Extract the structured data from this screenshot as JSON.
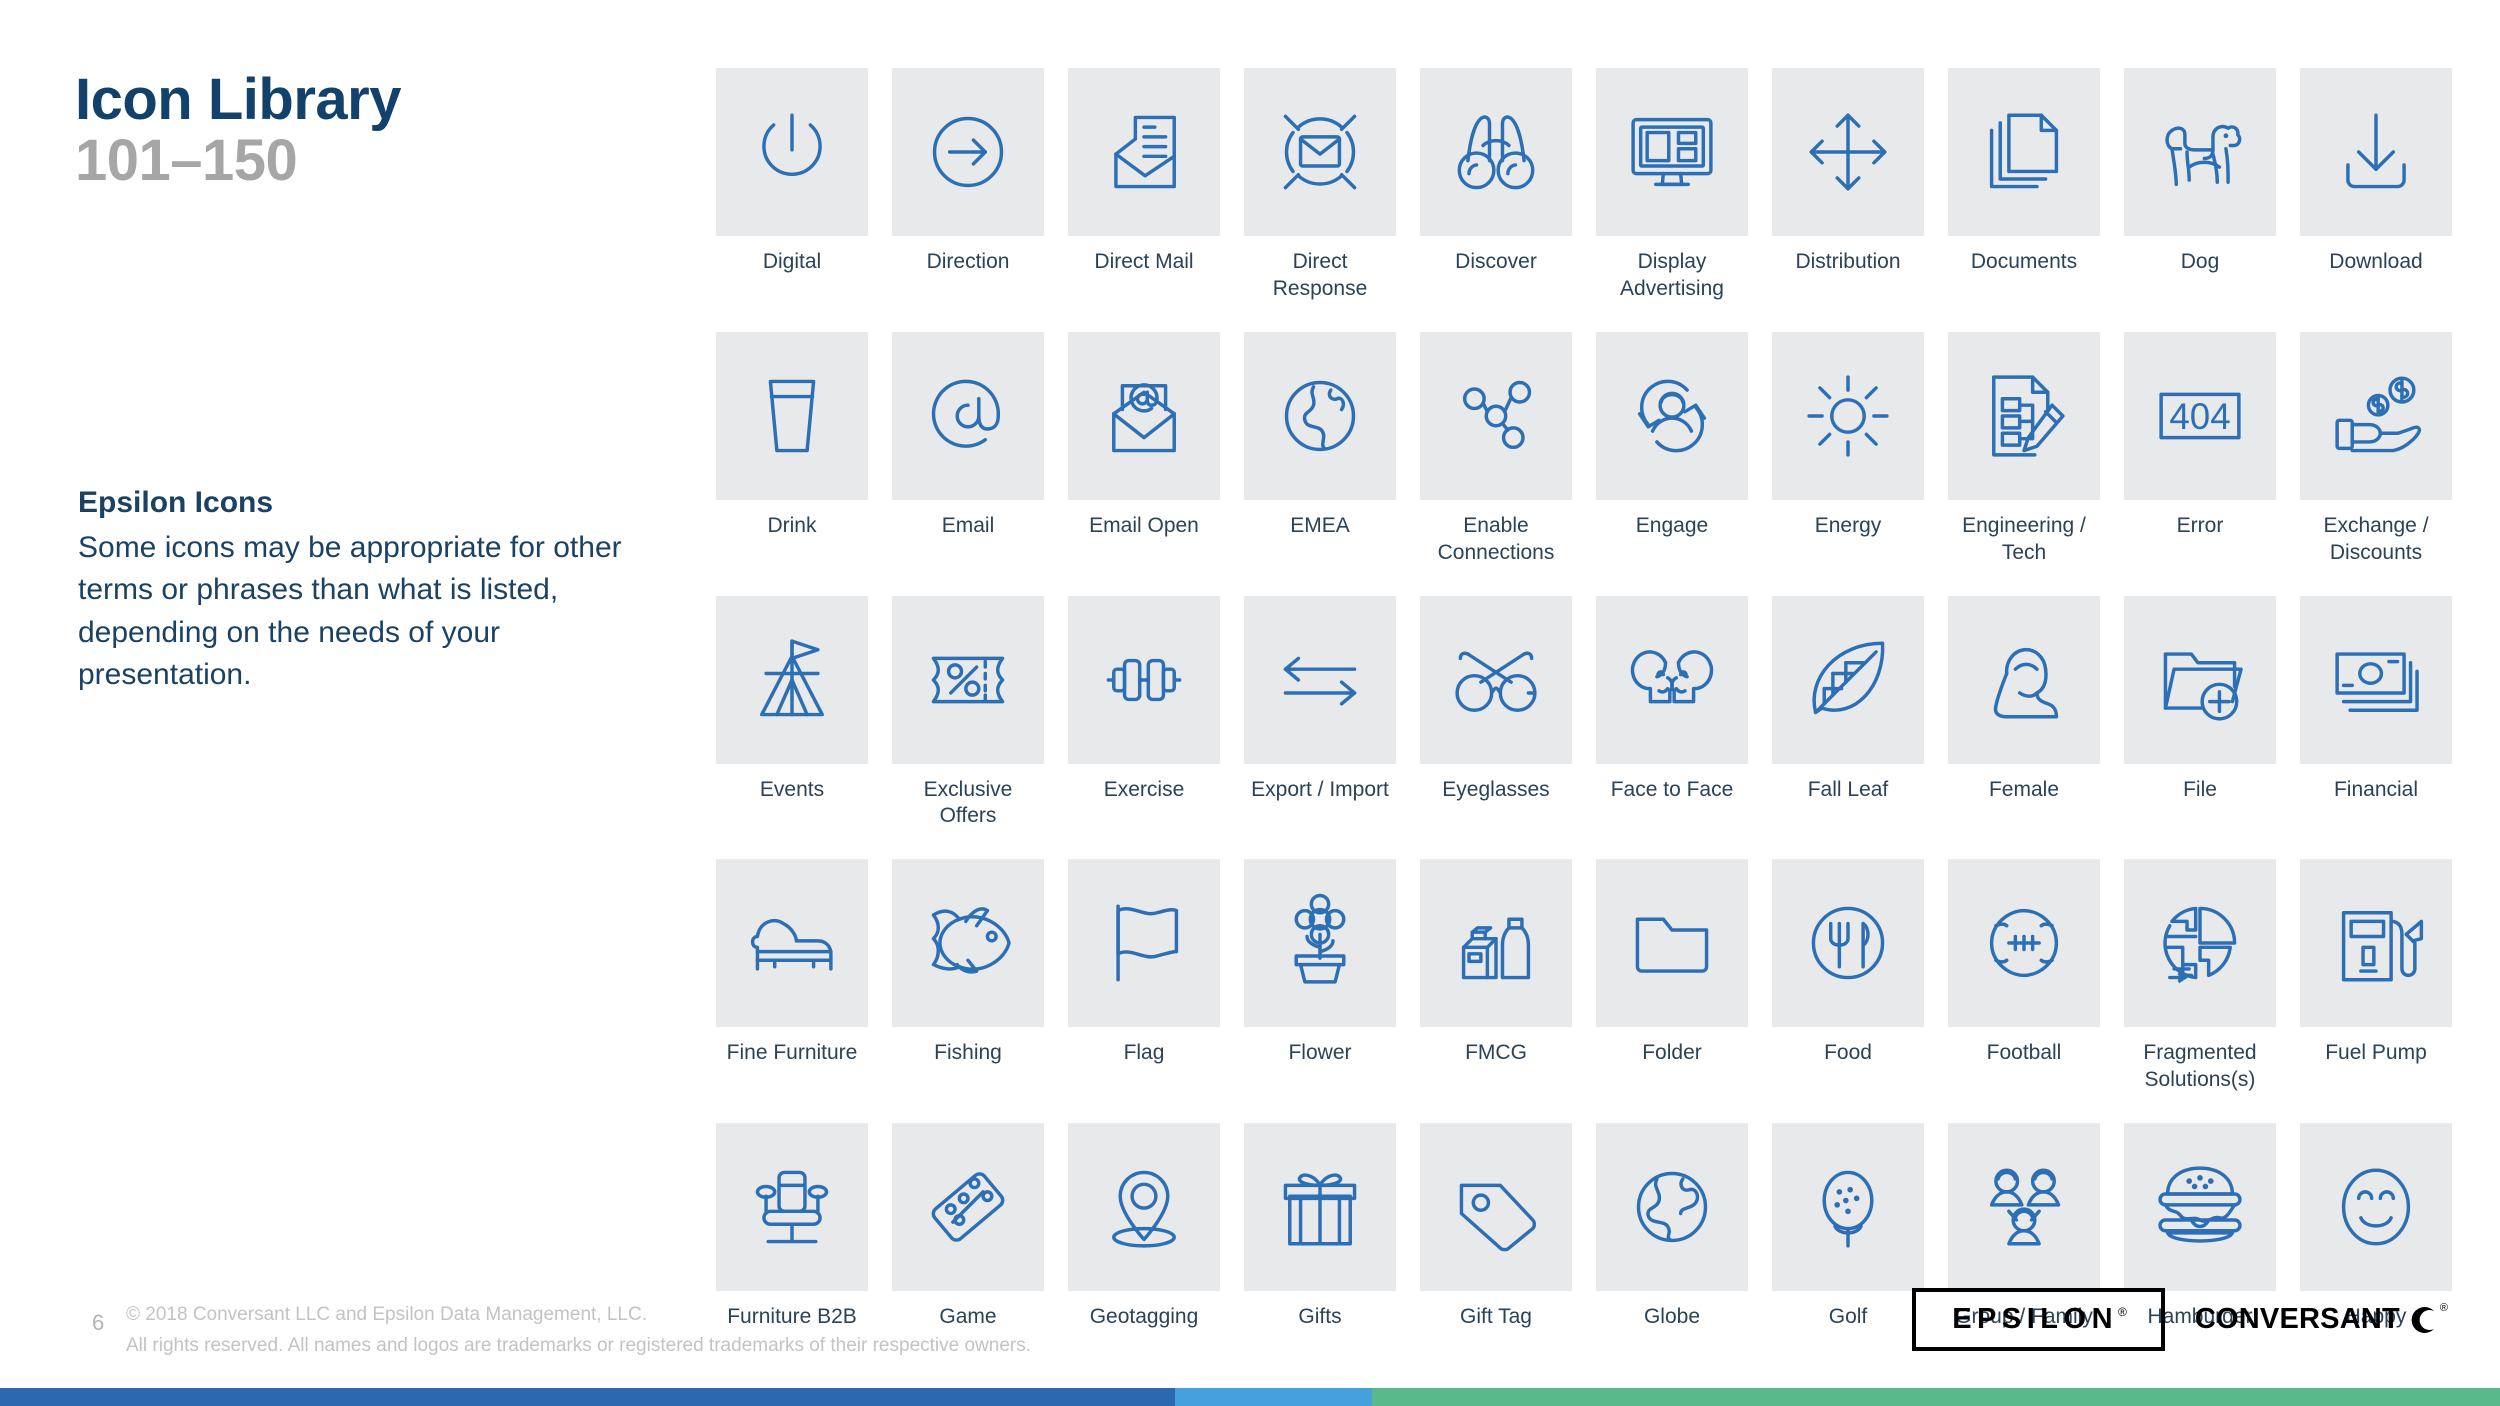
{
  "title": {
    "main": "Icon Library",
    "sub": "101–150"
  },
  "blurb": {
    "heading": "Epsilon Icons",
    "body": "Some icons may be appropriate for other terms or phrases than what is listed, depending on the needs of your presentation."
  },
  "colors": {
    "title_blue": "#12426b",
    "title_gray": "#a6a6a6",
    "body_blue": "#1b4263",
    "icon_blue": "#2c6fb5",
    "tile_gray": "#e8e9eb",
    "caption": "#2b4257",
    "accent_dark_blue": "#2c68b0",
    "accent_light_blue": "#45a0dd",
    "accent_green": "#5ab98a"
  },
  "icons": [
    {
      "label": "Digital",
      "icon": "power-icon"
    },
    {
      "label": "Direction",
      "icon": "arrow-right-circle-icon"
    },
    {
      "label": "Direct Mail",
      "icon": "mail-letter-icon"
    },
    {
      "label": "Direct Response",
      "icon": "envelope-burst-icon"
    },
    {
      "label": "Discover",
      "icon": "binoculars-icon"
    },
    {
      "label": "Display Advertising",
      "icon": "monitor-layout-icon"
    },
    {
      "label": "Distribution",
      "icon": "four-way-arrows-icon"
    },
    {
      "label": "Documents",
      "icon": "document-stack-icon"
    },
    {
      "label": "Dog",
      "icon": "dog-icon"
    },
    {
      "label": "Download",
      "icon": "download-tray-icon"
    },
    {
      "label": "Drink",
      "icon": "drinking-glass-icon"
    },
    {
      "label": "Email",
      "icon": "at-sign-icon"
    },
    {
      "label": "Email Open",
      "icon": "open-envelope-at-icon"
    },
    {
      "label": "EMEA",
      "icon": "globe-emea-icon"
    },
    {
      "label": "Enable Connections",
      "icon": "network-nodes-icon"
    },
    {
      "label": "Engage",
      "icon": "person-refresh-icon"
    },
    {
      "label": "Energy",
      "icon": "sun-icon"
    },
    {
      "label": "Engineering / Tech",
      "icon": "blueprint-pencil-icon"
    },
    {
      "label": "Error",
      "icon": "error-404-icon"
    },
    {
      "label": "Exchange / Discounts",
      "icon": "hand-coins-icon"
    },
    {
      "label": "Events",
      "icon": "tent-flag-icon"
    },
    {
      "label": "Exclusive Offers",
      "icon": "percent-ticket-icon"
    },
    {
      "label": "Exercise",
      "icon": "dumbbell-icon"
    },
    {
      "label": "Export / Import",
      "icon": "two-way-arrows-icon"
    },
    {
      "label": "Eyeglasses",
      "icon": "eyeglasses-icon"
    },
    {
      "label": "Face to Face",
      "icon": "two-heads-icon"
    },
    {
      "label": "Fall Leaf",
      "icon": "leaf-icon"
    },
    {
      "label": "Female",
      "icon": "female-bust-icon"
    },
    {
      "label": "File",
      "icon": "folder-plus-icon"
    },
    {
      "label": "Financial",
      "icon": "banknotes-icon"
    },
    {
      "label": "Fine Furniture",
      "icon": "chaise-lounge-icon"
    },
    {
      "label": "Fishing",
      "icon": "fish-icon"
    },
    {
      "label": "Flag",
      "icon": "flag-pole-icon"
    },
    {
      "label": "Flower",
      "icon": "potted-flower-icon"
    },
    {
      "label": "FMCG",
      "icon": "carton-bottle-icon"
    },
    {
      "label": "Folder",
      "icon": "folder-icon"
    },
    {
      "label": "Food",
      "icon": "fork-knife-circle-icon"
    },
    {
      "label": "Football",
      "icon": "football-icon"
    },
    {
      "label": "Fragmented Solutions(s)",
      "icon": "fragmented-pie-icon"
    },
    {
      "label": "Fuel Pump",
      "icon": "fuel-pump-icon"
    },
    {
      "label": "Furniture B2B",
      "icon": "office-chair-icon"
    },
    {
      "label": "Game",
      "icon": "domino-icon"
    },
    {
      "label": "Geotagging",
      "icon": "map-pin-icon"
    },
    {
      "label": "Gifts",
      "icon": "gift-box-icon"
    },
    {
      "label": "Gift Tag",
      "icon": "price-tag-icon"
    },
    {
      "label": "Globe",
      "icon": "globe-icon"
    },
    {
      "label": "Golf",
      "icon": "golf-ball-tee-icon"
    },
    {
      "label": "Group / Family",
      "icon": "group-people-icon"
    },
    {
      "label": "Hamburger",
      "icon": "hamburger-icon"
    },
    {
      "label": "Happy",
      "icon": "smiley-face-icon"
    }
  ],
  "footer": {
    "page_number": "6",
    "copyright_line1": "© 2018 Conversant LLC and Epsilon Data Management, LLC.",
    "copyright_line2": "All rights reserved. All names and logos are trademarks or registered trademarks of their respective owners.",
    "epsilon_logo_text": "EPSILON",
    "conversant_logo_text": "CONVERSANT"
  }
}
